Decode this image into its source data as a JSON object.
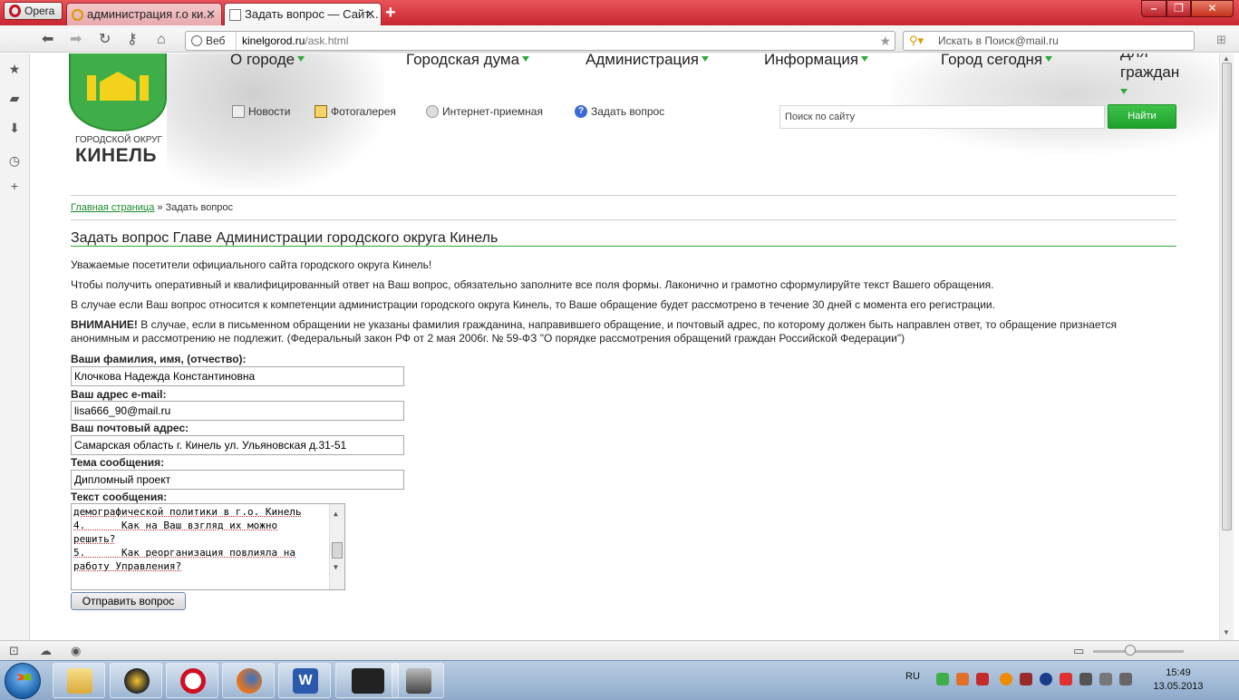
{
  "browser": {
    "menu_label": "Opera",
    "tabs": [
      {
        "title": "администрация г.о ки...",
        "active": false
      },
      {
        "title": "Задать вопрос — Сайт...",
        "active": true
      }
    ],
    "new_tab": "+",
    "address": {
      "mode": "Веб",
      "domain": "kinelgorod.ru",
      "path": "/ask.html"
    },
    "search_placeholder": "Искать в Поиск@mail.ru"
  },
  "site": {
    "logo_caption": "ГОРОДСКОЙ ОКРУГ",
    "logo_name": "КИНЕЛЬ",
    "nav": [
      {
        "label": "О городе"
      },
      {
        "label": "Городская дума"
      },
      {
        "label": "Администрация"
      },
      {
        "label": "Информация"
      },
      {
        "label": "Город сегодня"
      },
      {
        "label": "Для граждан"
      }
    ],
    "subnav": [
      {
        "label": "Новости"
      },
      {
        "label": "Фотогалерея"
      },
      {
        "label": "Интернет-приемная"
      },
      {
        "label": "Задать вопрос"
      }
    ],
    "search_placeholder": "Поиск по сайту",
    "search_button": "Найти"
  },
  "breadcrumb": {
    "home": "Главная страница",
    "separator": "»",
    "current": "Задать вопрос"
  },
  "content": {
    "title": "Задать вопрос Главе Администрации городского округа Кинель",
    "p1": "Уважаемые посетители официального сайта городского округа Кинель!",
    "p2": "Чтобы получить оперативный и квалифицированный ответ на Ваш вопрос, обязательно заполните все поля формы. Лаконично и грамотно сформулируйте текст Вашего обращения.",
    "p3": "В случае если Ваш вопрос относится к компетенции администрации городского округа Кинель, то Ваше обращение будет рассмотрено в течение 30 дней с момента его регистрации.",
    "warning_label": "ВНИМАНИЕ!",
    "warning_text": " В случае, если в письменном обращении не указаны фамилия гражданина, направившего обращение, и почтовый адрес, по которому должен быть направлен ответ, то обращение признается анонимным и рассмотрению не подлежит. (Федеральный закон РФ от 2 мая 2006г. № 59-ФЗ \"О порядке рассмотрения обращений граждан Российской Федерации\")"
  },
  "form": {
    "name_label": "Ваши фамилия, имя, (отчество):",
    "name_value": "Клочкова Надежда Константиновна",
    "email_label": "Ваш адрес e-mail:",
    "email_value": "lisa666_90@mail.ru",
    "address_label": "Ваш почтовый адрес:",
    "address_value": "Самарская область г. Кинель ул. Ульяновская д.31-51",
    "subject_label": "Тема сообщения:",
    "subject_value": "Дипломный проект",
    "message_label": "Текст сообщения:",
    "message_lines": [
      "демографической политики в г.о. Кинель",
      "4.      Как на Ваш взгляд их можно",
      "решить?",
      "5.      Как реорганизация повлияла на",
      "работу Управления?"
    ],
    "submit_label": "Отправить вопрос"
  },
  "taskbar": {
    "language": "RU",
    "time": "15:49",
    "date": "13.05.2013"
  }
}
